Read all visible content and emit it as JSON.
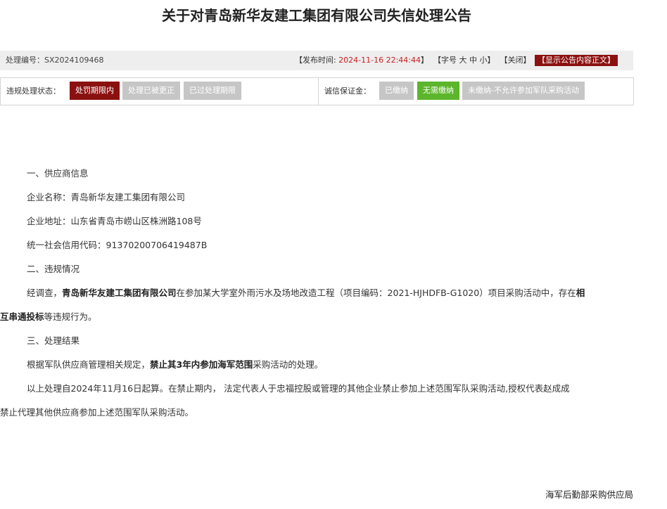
{
  "notice": {
    "title": "关于对青岛新华友建工集团有限公司失信处理公告"
  },
  "infobar": {
    "code_label": "处理编号：",
    "code_value": "SX2024109468",
    "publish_prefix": "【发布时间: ",
    "publish_time": "2024-11-16 22:44:44",
    "publish_suffix": "】",
    "font_prefix": "【字号 ",
    "font_large": "大",
    "font_medium": "中",
    "font_small": "小",
    "font_suffix": "】",
    "close_label": "【关闭】",
    "show_body_button": "【显示公告内容正文】"
  },
  "statusbar": {
    "violation_label": "违规处理状态：",
    "violation_states": [
      "处罚期限内",
      "处理已被更正",
      "已过处理期限"
    ],
    "deposit_label": "诚信保证金：",
    "deposit_states": [
      "已缴纳",
      "无需缴纳",
      "未缴纳-不允许参加军队采购活动"
    ],
    "colors": {
      "active_red": "#8b1111",
      "active_green": "#5cb52b",
      "inactive_gray": "#c6c6c6"
    }
  },
  "content": {
    "section1_heading": "一、供应商信息",
    "company_label": "企业名称：",
    "company_value": "青岛新华友建工集团有限公司",
    "address_label": "企业地址：",
    "address_value": "山东省青岛市崂山区株洲路108号",
    "credit_label": "统一社会信用代码：",
    "credit_value": "91370200706419487B",
    "section2_heading": "二、违规情况",
    "violation_intro": "经调查，",
    "violation_company": "青岛新华友建工集团有限公司",
    "violation_mid1": "在参加某大学室外雨污水及场地改造工程（项目编码：2021-HJHDFB-G1020）项目采购活动中，存在",
    "violation_bold_line1": "相",
    "violation_bold_line2": "互串通投标",
    "violation_end": "等违规行为。",
    "section3_heading": "三、处理结果",
    "result_prefix": "根据军队供应商管理相关规定，",
    "result_bold": "禁止其3年内参加海军范围",
    "result_suffix": "采购活动的处理。",
    "period_line1": "以上处理自2024年11月16日起算。在禁止期内， 法定代表人于忠福控股或管理的其他企业禁止参加上述范围军队采购活动,授权代表赵成成",
    "period_line2": "禁止代理其他供应商参加上述范围军队采购活动。"
  },
  "footer": {
    "organization": "海军后勤部采购供应局"
  }
}
